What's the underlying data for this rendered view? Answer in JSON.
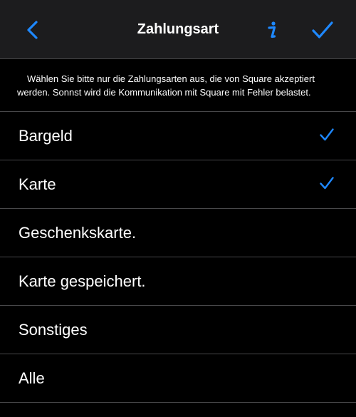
{
  "nav": {
    "title": "Zahlungsart",
    "back_icon": "chevron-left-icon",
    "info_icon": "info-icon",
    "done_icon": "checkmark-icon",
    "accent_color": "#1e88ff"
  },
  "note": {
    "line1": "Wählen Sie bitte nur die Zahlungsarten aus, die von Square akzeptiert",
    "line2": "werden. Sonnst wird die Kommunikation mit Square mit Fehler belastet."
  },
  "options": [
    {
      "label": "Bargeld",
      "selected": true
    },
    {
      "label": "Karte",
      "selected": true
    },
    {
      "label": "Geschenkskarte.",
      "selected": false
    },
    {
      "label": "Karte gespeichert.",
      "selected": false
    },
    {
      "label": "Sonstiges",
      "selected": false
    },
    {
      "label": "Alle",
      "selected": false
    }
  ]
}
